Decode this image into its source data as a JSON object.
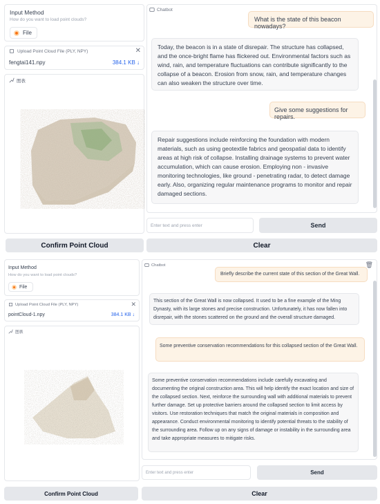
{
  "panels": [
    {
      "input_method": {
        "title": "Input Method",
        "subtitle": "How do you want to load point clouds?",
        "option": "File"
      },
      "upload": {
        "label": "Upload Point Cloud File (PLY, NPY)",
        "file_name": "fengtai141.npy",
        "file_size": "384.1 KB ↓"
      },
      "plot": {
        "label": "图表"
      },
      "chatbot": {
        "label": "Chatbot",
        "messages": [
          {
            "role": "user",
            "text": "What is the state of this beacon nowadays?"
          },
          {
            "role": "bot",
            "text": "Today, the beacon is in a state of disrepair. The structure has collapsed, and the once-bright flame has flickered out. Environmental factors such as wind, rain, and temperature fluctuations can contribute significantly to the collapse of a beacon. Erosion from snow, rain, and temperature changes can also weaken the structure over time."
          },
          {
            "role": "user",
            "text": "Give some suggestions for repairs."
          },
          {
            "role": "bot",
            "text": "Repair suggestions include reinforcing the foundation with modern materials, such as using geotextile fabrics and geospatial data to identify areas at high risk of collapse. Installing drainage systems to prevent water accumulation, which can cause erosion. Employing non - invasive monitoring technologies, like ground - penetrating radar, to detect damage early. Also, organizing regular maintenance programs to monitor and repair damaged sections."
          }
        ]
      },
      "input_placeholder": "Enter text and press enter",
      "send_label": "Send",
      "confirm_label": "Confirm Point Cloud",
      "clear_label": "Clear"
    },
    {
      "input_method": {
        "title": "Input Method",
        "subtitle": "How do you want to load point clouds?",
        "option": "File"
      },
      "upload": {
        "label": "Upload Point Cloud File (PLY, NPY)",
        "file_name": "pointCloud-1.npy",
        "file_size": "384.1 KB ↓"
      },
      "plot": {
        "label": "图表"
      },
      "chatbot": {
        "label": "Chatbot",
        "messages": [
          {
            "role": "user",
            "text": "Briefly describe the current state of this section of the Great Wall."
          },
          {
            "role": "bot",
            "text": "This section of the Great Wall is now collapsed. It used to be a fine example of the Ming Dynasty, with its large stones and precise construction. Unfortunately, it has now fallen into disrepair, with the stones scattered on the ground and the overall structure damaged."
          },
          {
            "role": "user",
            "text": "Some preventive conservation recommendations for this collapsed section of the Great Wall."
          },
          {
            "role": "bot",
            "text": "Some preventive conservation recommendations include carefully excavating and documenting the original construction area. This will help identify the exact location and size of the collapsed section. Next, reinforce the surrounding wall with additional materials to prevent further damage. Set up protective barriers around the collapsed section to limit access by visitors. Use restoration techniques that match the original materials in composition and appearance. Conduct environmental monitoring to identify potential threats to the stability of the surrounding area. Follow up on any signs of damage or instability in the surrounding area and take appropriate measures to mitigate risks."
          }
        ]
      },
      "input_placeholder": "Enter text and press enter",
      "send_label": "Send",
      "confirm_label": "Confirm Point Cloud",
      "clear_label": "Clear"
    }
  ],
  "colors": {
    "accent": "#f97316",
    "user_bubble": "#fdf3e6",
    "bot_bubble": "#f7f7f8",
    "button": "#e5e7eb",
    "link": "#2563eb"
  },
  "icons": [
    "upload-icon",
    "close-icon",
    "chart-icon",
    "chatbot-icon",
    "trash-icon",
    "download-icon"
  ]
}
